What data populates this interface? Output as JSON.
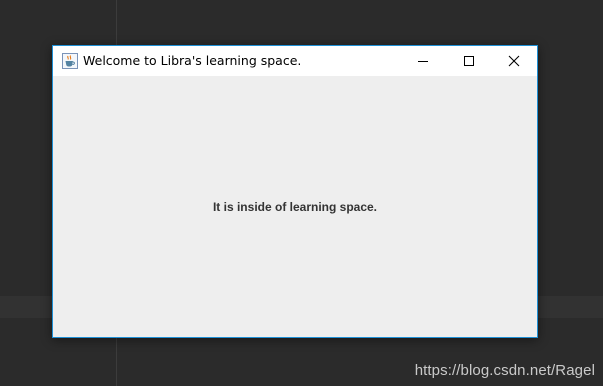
{
  "window": {
    "title": "Welcome to Libra's learning space.",
    "app_icon": "java-coffee-cup-icon",
    "controls": {
      "minimize_icon": "minimize-icon",
      "maximize_icon": "maximize-icon",
      "close_icon": "close-icon"
    }
  },
  "content": {
    "message": "It is inside of learning space."
  },
  "watermark": "https://blog.csdn.net/Ragel",
  "colors": {
    "desktop_background": "#2b2b2b",
    "window_border": "#1e90d6",
    "titlebar_background": "#ffffff",
    "content_background": "#eeeeee",
    "message_text": "#333333"
  }
}
